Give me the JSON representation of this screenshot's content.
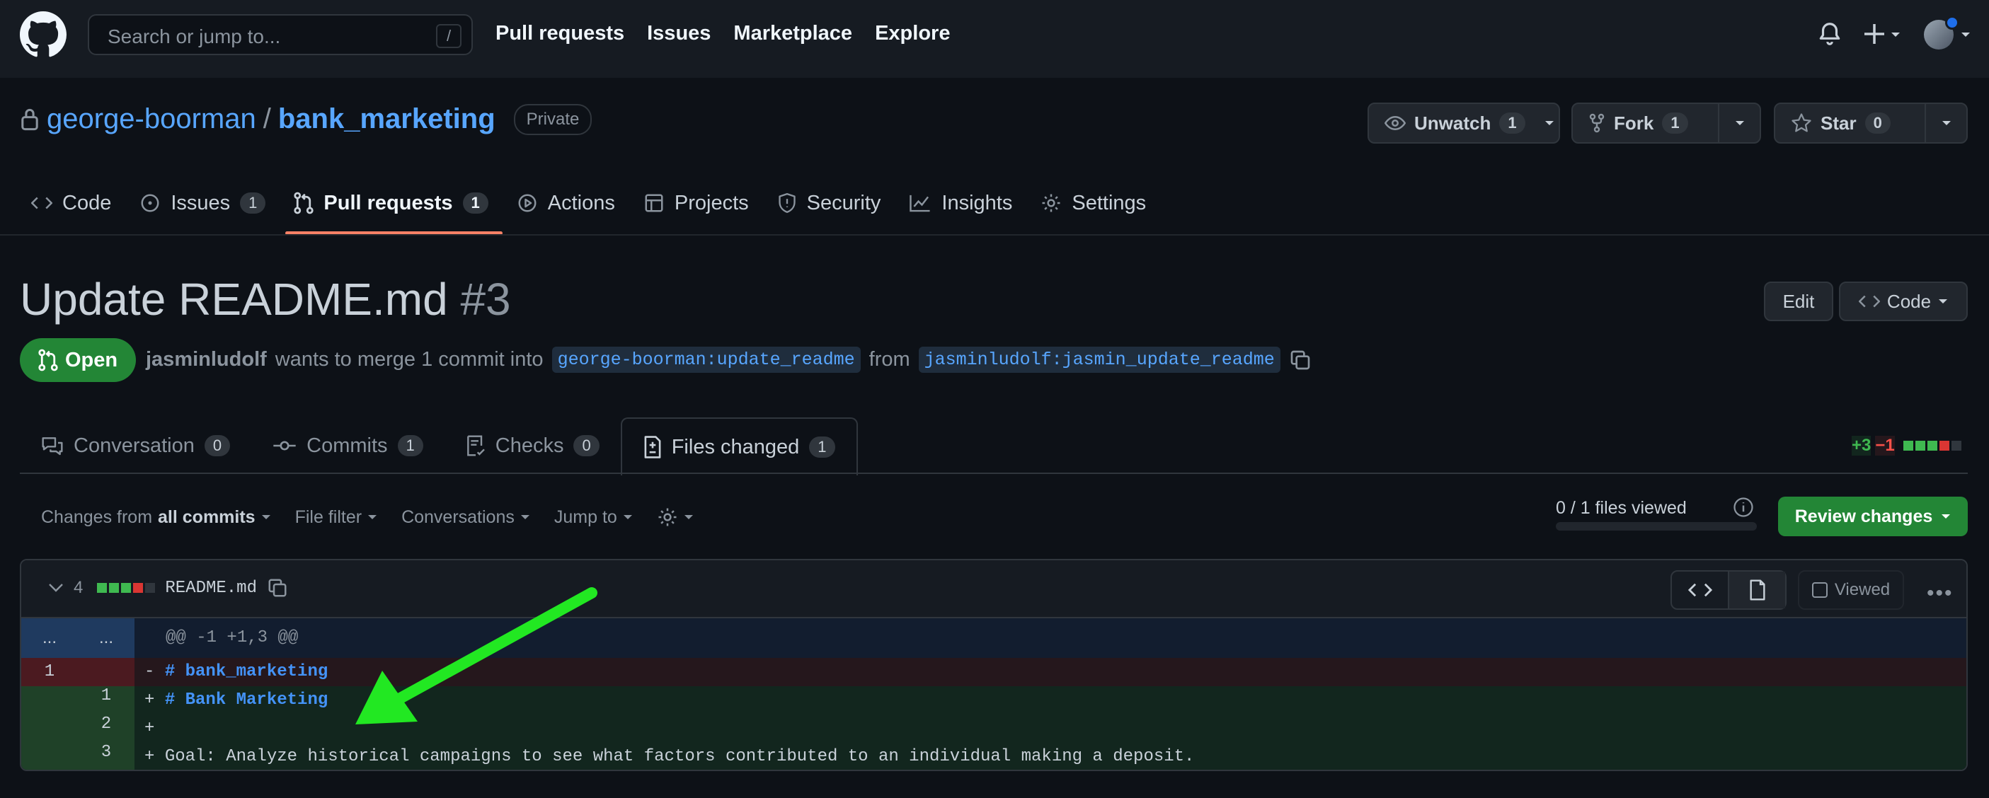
{
  "header": {
    "search_placeholder": "Search or jump to...",
    "search_shortcut": "/",
    "nav": [
      "Pull requests",
      "Issues",
      "Marketplace",
      "Explore"
    ]
  },
  "repo": {
    "owner": "george-boorman",
    "separator": "/",
    "name": "bank_marketing",
    "visibility": "Private",
    "unwatch_label": "Unwatch",
    "unwatch_count": "1",
    "fork_label": "Fork",
    "fork_count": "1",
    "star_label": "Star",
    "star_count": "0"
  },
  "repo_tabs": [
    {
      "label": "Code",
      "count": null
    },
    {
      "label": "Issues",
      "count": "1"
    },
    {
      "label": "Pull requests",
      "count": "1"
    },
    {
      "label": "Actions",
      "count": null
    },
    {
      "label": "Projects",
      "count": null
    },
    {
      "label": "Security",
      "count": null
    },
    {
      "label": "Insights",
      "count": null
    },
    {
      "label": "Settings",
      "count": null
    }
  ],
  "pr": {
    "title": "Update README.md",
    "number": "#3",
    "edit_label": "Edit",
    "code_label": "Code",
    "state": "Open",
    "author": "jasminludolf",
    "merge_text": "wants to merge 1 commit into",
    "base_branch": "george-boorman:update_readme",
    "from_text": "from",
    "head_branch": "jasminludolf:jasmin_update_readme"
  },
  "pr_tabs": [
    {
      "label": "Conversation",
      "count": "0"
    },
    {
      "label": "Commits",
      "count": "1"
    },
    {
      "label": "Checks",
      "count": "0"
    },
    {
      "label": "Files changed",
      "count": "1"
    }
  ],
  "diffstat": {
    "additions": "+3",
    "deletions": "−1"
  },
  "toolbar": {
    "changes_from": "Changes from",
    "all_commits": "all commits",
    "file_filter": "File filter",
    "conversations": "Conversations",
    "jump_to": "Jump to",
    "files_viewed": "0 / 1 files viewed",
    "viewed_fraction": 0,
    "review_label": "Review changes"
  },
  "file": {
    "change_count": "4",
    "filename": "README.md",
    "viewed_label": "Viewed",
    "hunk_left": "...",
    "hunk_right": "...",
    "hunk_header": "@@ -1 +1,3 @@",
    "lines": [
      {
        "type": "del",
        "old": "1",
        "new": "",
        "sign": "-",
        "text": "# bank_marketing",
        "heading": true
      },
      {
        "type": "add",
        "old": "",
        "new": "1",
        "sign": "+",
        "text": "# Bank Marketing",
        "heading": true
      },
      {
        "type": "add",
        "old": "",
        "new": "2",
        "sign": "+",
        "text": "",
        "heading": false
      },
      {
        "type": "add",
        "old": "",
        "new": "3",
        "sign": "+",
        "text": "Goal: Analyze historical campaigns to see what factors contributed to an individual making a deposit.",
        "heading": false
      }
    ]
  },
  "colors": {
    "accent_link": "#58a6ff",
    "open_green": "#238636",
    "tab_underline": "#f78166",
    "annotation_arrow": "#22e822"
  }
}
